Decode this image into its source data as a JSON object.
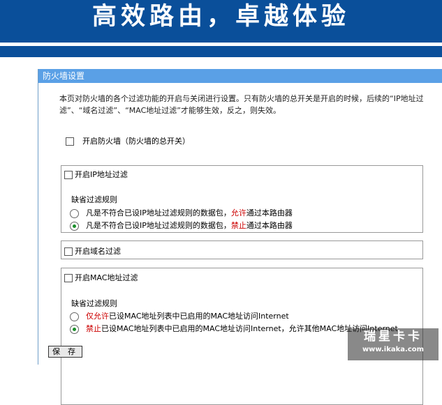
{
  "banner": {
    "title": "高效路由，卓越体验"
  },
  "panel": {
    "title": "防火墙设置",
    "description": "本页对防火墙的各个过滤功能的开启与关闭进行设置。只有防火墙的总开关是开启的时候，后续的“IP地址过滤”、“域名过滤”、“MAC地址过滤”才能够生效，反之，则失效。"
  },
  "master": {
    "label": "开启防火墙（防火墙的总开关）",
    "checked": false
  },
  "ip_filter": {
    "label": "开启IP地址过滤",
    "checked": false,
    "default_rule_label": "缺省过滤规则",
    "options": [
      {
        "pre": "凡是不符合已设IP地址过滤规则的数据包，",
        "em": "允许",
        "post": "通过本路由器",
        "selected": false
      },
      {
        "pre": "凡是不符合已设IP地址过滤规则的数据包，",
        "em": "禁止",
        "post": "通过本路由器",
        "selected": true
      }
    ]
  },
  "domain_filter": {
    "label": "开启域名过滤",
    "checked": false
  },
  "mac_filter": {
    "label": "开启MAC地址过滤",
    "checked": false,
    "default_rule_label": "缺省过滤规则",
    "options": [
      {
        "pre": "",
        "em": "仅允许",
        "post": "已设MAC地址列表中已启用的MAC地址访问Internet",
        "selected": false
      },
      {
        "pre": "",
        "em": "禁止",
        "post": "已设MAC地址列表中已启用的MAC地址访问Internet，允许其他MAC地址访问Internet",
        "selected": true
      }
    ]
  },
  "buttons": {
    "save": "保 存"
  },
  "watermark": {
    "text": "瑞星卡卡",
    "url": "www.ikaka.com"
  },
  "colors": {
    "banner": "#0a4f9a",
    "panel_header": "#5aa0e6",
    "accent_red": "#cc0000",
    "radio_dot": "#1a8f2a"
  }
}
